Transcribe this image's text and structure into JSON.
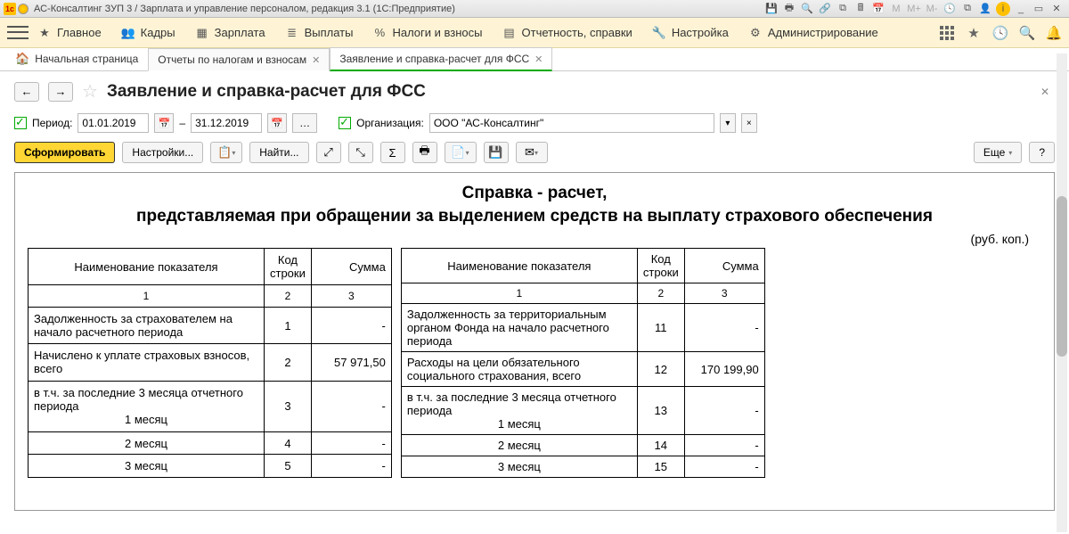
{
  "titlebar": {
    "text": "АС-Консалтинг ЗУП 3 / Зарплата и управление персоналом, редакция 3.1  (1С:Предприятие)"
  },
  "menu": {
    "main": "Главное",
    "kadry": "Кадры",
    "zarplata": "Зарплата",
    "vyplaty": "Выплаты",
    "nalogi": "Налоги и взносы",
    "otchet": "Отчетность, справки",
    "nastroyka": "Настройка",
    "admin": "Администрирование"
  },
  "tabs": {
    "home": "Начальная страница",
    "t1": "Отчеты по налогам и взносам",
    "t2": "Заявление и справка-расчет для ФСС"
  },
  "page": {
    "title": "Заявление и справка-расчет для ФСС"
  },
  "filters": {
    "period_label": "Период:",
    "date_from": "01.01.2019",
    "date_to": "31.12.2019",
    "dash": "–",
    "org_label": "Организация:",
    "org_value": "ООО \"АС-Консалтинг\""
  },
  "toolbar": {
    "form": "Сформировать",
    "settings": "Настройки...",
    "find": "Найти...",
    "more": "Еще",
    "help": "?"
  },
  "report": {
    "title1": "Справка - расчет,",
    "title2": "представляемая при обращении за выделением средств на выплату страхового обеспечения",
    "currency": "(руб. коп.)",
    "headers": {
      "name": "Наименование показателя",
      "code": "Код строки",
      "sum": "Сумма",
      "h1": "1",
      "h2": "2",
      "h3": "3"
    },
    "left": [
      {
        "name": "Задолженность за страхователем на начало расчетного периода",
        "code": "1",
        "sum": "-"
      },
      {
        "name": "Начислено к уплате страховых взносов, всего",
        "code": "2",
        "sum": "57 971,50"
      },
      {
        "name": "в т.ч. за последние 3 месяца отчетного периода",
        "sub": "1 месяц",
        "code": "3",
        "sum": "-"
      },
      {
        "sub": "2 месяц",
        "code": "4",
        "sum": "-"
      },
      {
        "sub": "3 месяц",
        "code": "5",
        "sum": "-"
      }
    ],
    "right": [
      {
        "name": "Задолженность за территориальным органом Фонда на  начало расчетного периода",
        "code": "11",
        "sum": "-"
      },
      {
        "name": "Расходы на цели обязательного социального страхования, всего",
        "code": "12",
        "sum": "170 199,90"
      },
      {
        "name": "в т.ч. за последние 3 месяца отчетного периода",
        "sub": "1 месяц",
        "code": "13",
        "sum": "-"
      },
      {
        "sub": "2 месяц",
        "code": "14",
        "sum": "-"
      },
      {
        "sub": "3 месяц",
        "code": "15",
        "sum": "-"
      }
    ]
  }
}
